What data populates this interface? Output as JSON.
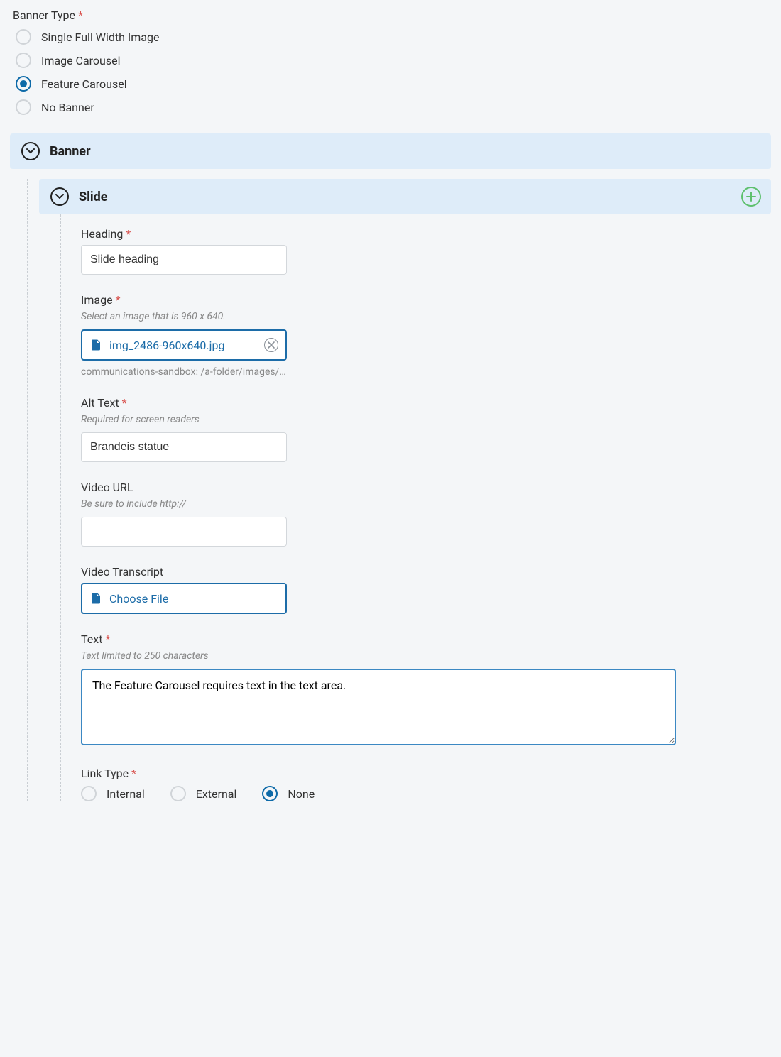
{
  "bannerType": {
    "label": "Banner Type",
    "options": [
      {
        "label": "Single Full Width Image"
      },
      {
        "label": "Image Carousel"
      },
      {
        "label": "Feature Carousel"
      },
      {
        "label": "No Banner"
      }
    ],
    "selectedIndex": 2
  },
  "sections": {
    "banner": {
      "title": "Banner"
    },
    "slide": {
      "title": "Slide"
    }
  },
  "slide": {
    "heading": {
      "label": "Heading",
      "value": "Slide heading"
    },
    "image": {
      "label": "Image",
      "hint": "Select an image that is 960 x 640.",
      "filename": "img_2486-960x640.jpg",
      "path": "communications-sandbox: /a-folder/images/…"
    },
    "altText": {
      "label": "Alt Text",
      "hint": "Required for screen readers",
      "value": "Brandeis statue"
    },
    "videoURL": {
      "label": "Video URL",
      "hint": "Be sure to include http://",
      "value": ""
    },
    "videoTranscript": {
      "label": "Video Transcript",
      "chooseLabel": "Choose File"
    },
    "text": {
      "label": "Text",
      "hint": "Text limited to 250 characters",
      "value": "The Feature Carousel requires text in the text area."
    },
    "linkType": {
      "label": "Link Type",
      "options": [
        {
          "label": "Internal"
        },
        {
          "label": "External"
        },
        {
          "label": "None"
        }
      ],
      "selectedIndex": 2
    }
  }
}
